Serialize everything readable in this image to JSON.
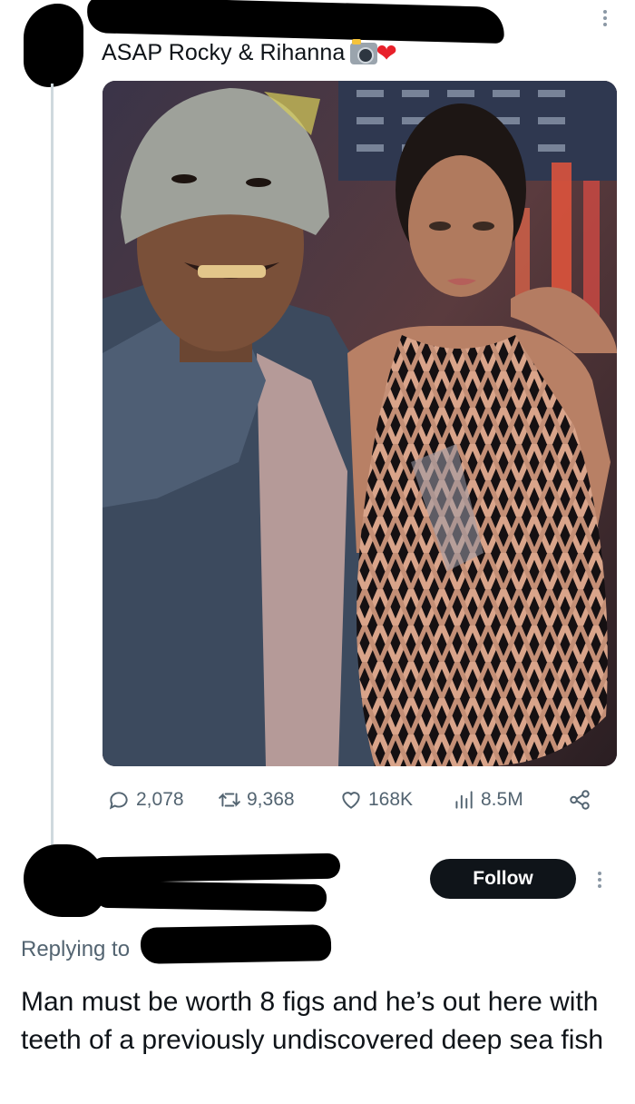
{
  "original_tweet": {
    "text": "ASAP Rocky & Rihanna",
    "emojis": [
      "camera-with-flash-icon",
      "red-heart-icon"
    ],
    "photo_alt": "photo"
  },
  "actions": {
    "replies": "2,078",
    "retweets": "9,368",
    "likes": "168K",
    "views": "8.5M"
  },
  "reply_tweet": {
    "follow_label": "Follow",
    "replying_to_label": "Replying to",
    "text": "Man must be worth 8 figs and he’s out here with teeth of a previously undiscovered deep sea fish"
  },
  "colors": {
    "text_primary": "#0f1419",
    "text_secondary": "#536471",
    "thread_line": "#cfd9de",
    "follow_button_bg": "#0f1419",
    "heart": "#e8202a"
  }
}
